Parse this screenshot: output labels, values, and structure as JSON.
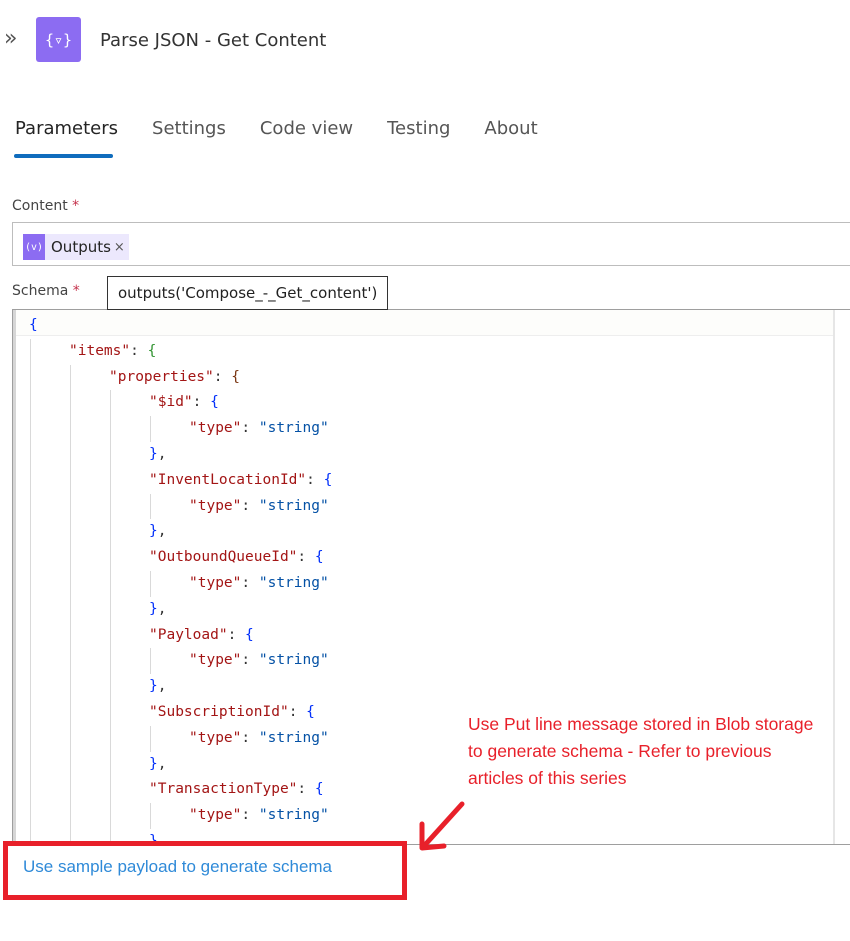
{
  "header": {
    "title": "Parse JSON - Get Content",
    "collapse_icon": "double-chevron-right-icon",
    "action_icon": "parse-json-icon",
    "action_icon_glyph": "{▿}",
    "accent_color": "#8c6cf2"
  },
  "tabs": [
    {
      "label": "Parameters",
      "active": true
    },
    {
      "label": "Settings",
      "active": false
    },
    {
      "label": "Code view",
      "active": false
    },
    {
      "label": "Testing",
      "active": false
    },
    {
      "label": "About",
      "active": false
    }
  ],
  "content_field": {
    "label": "Content",
    "required_mark": "*",
    "token": {
      "icon_glyph": "(v)",
      "label": "Outputs",
      "remove_glyph": "×"
    }
  },
  "schema_field": {
    "label": "Schema",
    "required_mark": "*",
    "tooltip": "outputs('Compose_-_Get_content')",
    "code_lines": [
      {
        "indent": 0,
        "parts": [
          [
            "b-blue",
            "{"
          ]
        ]
      },
      {
        "indent": 1,
        "parts": [
          [
            "k",
            "\"items\""
          ],
          [
            "p",
            ": "
          ],
          [
            "b-green",
            "{"
          ]
        ]
      },
      {
        "indent": 2,
        "parts": [
          [
            "k",
            "\"properties\""
          ],
          [
            "p",
            ": "
          ],
          [
            "b-brown",
            "{"
          ]
        ]
      },
      {
        "indent": 3,
        "parts": [
          [
            "k",
            "\"$id\""
          ],
          [
            "p",
            ": "
          ],
          [
            "b-blue",
            "{"
          ]
        ]
      },
      {
        "indent": 4,
        "parts": [
          [
            "k",
            "\"type\""
          ],
          [
            "p",
            ": "
          ],
          [
            "s",
            "\"string\""
          ]
        ]
      },
      {
        "indent": 3,
        "parts": [
          [
            "b-blue",
            "}"
          ],
          [
            "p",
            ","
          ]
        ]
      },
      {
        "indent": 3,
        "parts": [
          [
            "k",
            "\"InventLocationId\""
          ],
          [
            "p",
            ": "
          ],
          [
            "b-blue",
            "{"
          ]
        ]
      },
      {
        "indent": 4,
        "parts": [
          [
            "k",
            "\"type\""
          ],
          [
            "p",
            ": "
          ],
          [
            "s",
            "\"string\""
          ]
        ]
      },
      {
        "indent": 3,
        "parts": [
          [
            "b-blue",
            "}"
          ],
          [
            "p",
            ","
          ]
        ]
      },
      {
        "indent": 3,
        "parts": [
          [
            "k",
            "\"OutboundQueueId\""
          ],
          [
            "p",
            ": "
          ],
          [
            "b-blue",
            "{"
          ]
        ]
      },
      {
        "indent": 4,
        "parts": [
          [
            "k",
            "\"type\""
          ],
          [
            "p",
            ": "
          ],
          [
            "s",
            "\"string\""
          ]
        ]
      },
      {
        "indent": 3,
        "parts": [
          [
            "b-blue",
            "}"
          ],
          [
            "p",
            ","
          ]
        ]
      },
      {
        "indent": 3,
        "parts": [
          [
            "k",
            "\"Payload\""
          ],
          [
            "p",
            ": "
          ],
          [
            "b-blue",
            "{"
          ]
        ]
      },
      {
        "indent": 4,
        "parts": [
          [
            "k",
            "\"type\""
          ],
          [
            "p",
            ": "
          ],
          [
            "s",
            "\"string\""
          ]
        ]
      },
      {
        "indent": 3,
        "parts": [
          [
            "b-blue",
            "}"
          ],
          [
            "p",
            ","
          ]
        ]
      },
      {
        "indent": 3,
        "parts": [
          [
            "k",
            "\"SubscriptionId\""
          ],
          [
            "p",
            ": "
          ],
          [
            "b-blue",
            "{"
          ]
        ]
      },
      {
        "indent": 4,
        "parts": [
          [
            "k",
            "\"type\""
          ],
          [
            "p",
            ": "
          ],
          [
            "s",
            "\"string\""
          ]
        ]
      },
      {
        "indent": 3,
        "parts": [
          [
            "b-blue",
            "}"
          ],
          [
            "p",
            ","
          ]
        ]
      },
      {
        "indent": 3,
        "parts": [
          [
            "k",
            "\"TransactionType\""
          ],
          [
            "p",
            ": "
          ],
          [
            "b-blue",
            "{"
          ]
        ]
      },
      {
        "indent": 4,
        "parts": [
          [
            "k",
            "\"type\""
          ],
          [
            "p",
            ": "
          ],
          [
            "s",
            "\"string\""
          ]
        ]
      },
      {
        "indent": 3,
        "parts": [
          [
            "b-blue",
            "}"
          ],
          [
            "p",
            ","
          ]
        ]
      }
    ]
  },
  "generate_link": "Use sample payload to generate schema",
  "annotation": {
    "text": "Use Put line message stored in Blob storage to generate schema - Refer to previous articles of this series",
    "color": "#e8202a"
  }
}
